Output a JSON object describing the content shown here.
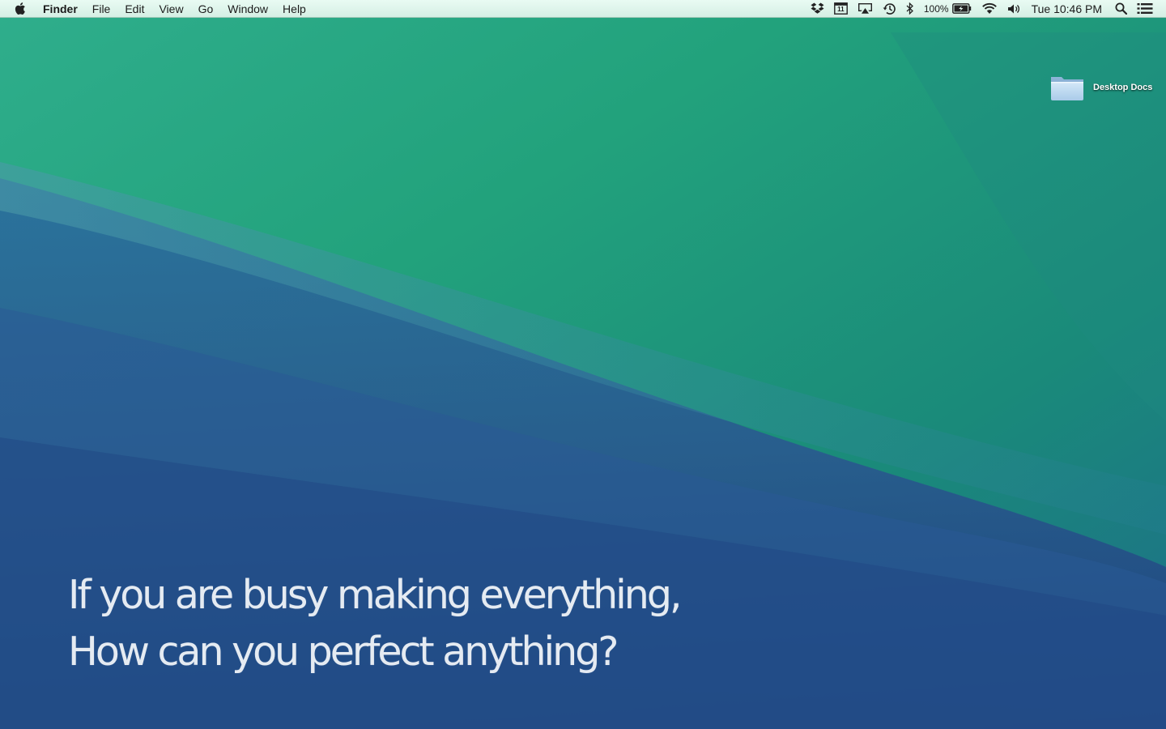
{
  "menubar": {
    "app_name": "Finder",
    "menus": [
      "File",
      "Edit",
      "View",
      "Go",
      "Window",
      "Help"
    ],
    "battery_percent": "100%",
    "clock": "Tue 10:46 PM",
    "calendar_day": "11",
    "status_icons": [
      "dropbox-icon",
      "calendar-icon",
      "airplay-icon",
      "time-machine-icon",
      "bluetooth-icon",
      "battery-icon",
      "wifi-icon",
      "volume-icon",
      "spotlight-icon",
      "notification-center-icon"
    ]
  },
  "desktop": {
    "folder_label": "Desktop Docs"
  },
  "quote": {
    "line1": "If you are busy making everything,",
    "line2": "How can you perfect anything?"
  }
}
